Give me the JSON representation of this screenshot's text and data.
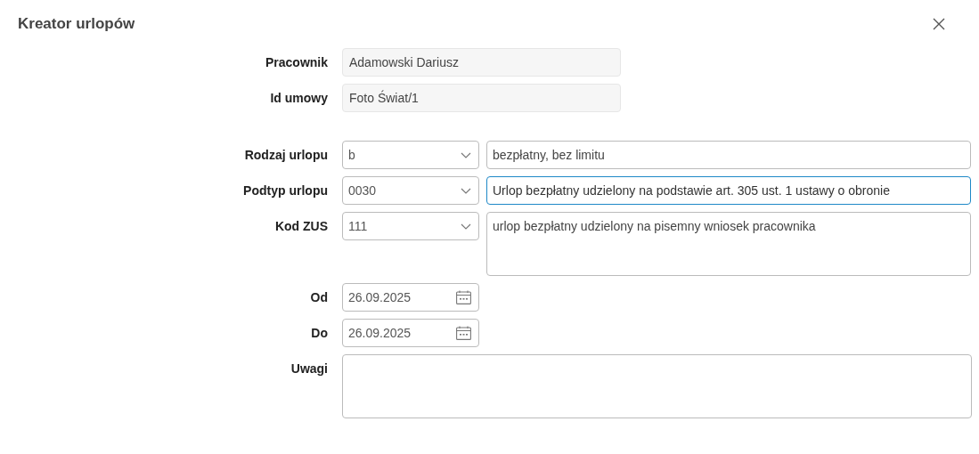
{
  "window": {
    "title": "Kreator urlopów"
  },
  "fields": [
    {
      "kind": "readonly",
      "label": "Pracownik",
      "value": "Adamowski Dariusz"
    },
    {
      "kind": "readonly",
      "label": "Id umowy",
      "value": "Foto Świat/1"
    },
    {
      "kind": "select",
      "label": "Rodzaj urlopu",
      "value": "b",
      "description": "bezpłatny, bez limitu",
      "multiline": false,
      "focused": false
    },
    {
      "kind": "select",
      "label": "Podtyp urlopu",
      "value": "0030",
      "description": "Urlop bezpłatny udzielony na podstawie art. 305 ust. 1 ustawy o obronie",
      "multiline": false,
      "focused": true
    },
    {
      "kind": "select",
      "label": "Kod ZUS",
      "value": "111",
      "description": "urlop bezpłatny udzielony na pisemny wniosek pracownika",
      "multiline": true,
      "focused": false
    },
    {
      "kind": "date",
      "label": "Od",
      "value": "26.09.2025"
    },
    {
      "kind": "date",
      "label": "Do",
      "value": "26.09.2025"
    },
    {
      "kind": "textarea",
      "label": "Uwagi"
    }
  ]
}
